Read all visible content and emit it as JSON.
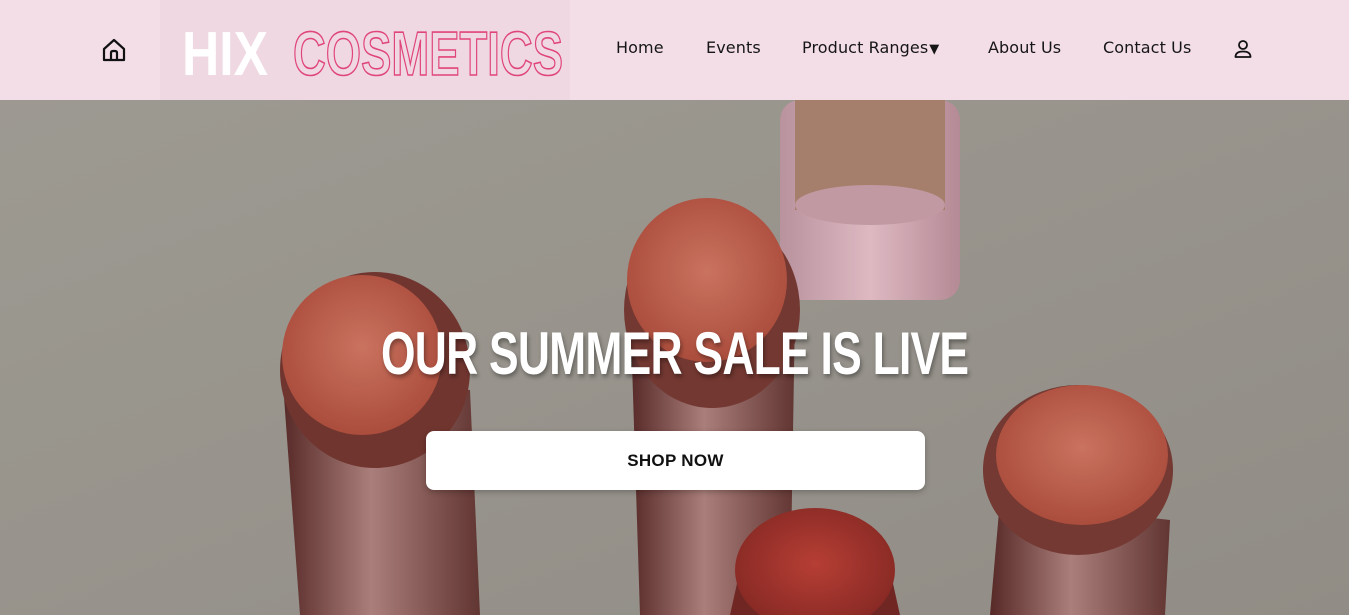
{
  "header": {
    "logo": {
      "word1": "HIX",
      "word2": "COSMETICS"
    },
    "nav": [
      {
        "label": "Home"
      },
      {
        "label": "Events"
      },
      {
        "label": "Product Ranges",
        "caret": "▼"
      },
      {
        "label": "About Us"
      },
      {
        "label": "Contact Us"
      }
    ],
    "icons": {
      "home": "home-icon",
      "account": "user-icon"
    }
  },
  "hero": {
    "title": "OUR SUMMER SALE IS LIVE",
    "button_label": "SHOP NOW"
  },
  "colors": {
    "header_bg": "#f3dde6",
    "logo_outline": "#e0457a",
    "hero_text": "#ffffff",
    "button_bg": "#ffffff"
  }
}
